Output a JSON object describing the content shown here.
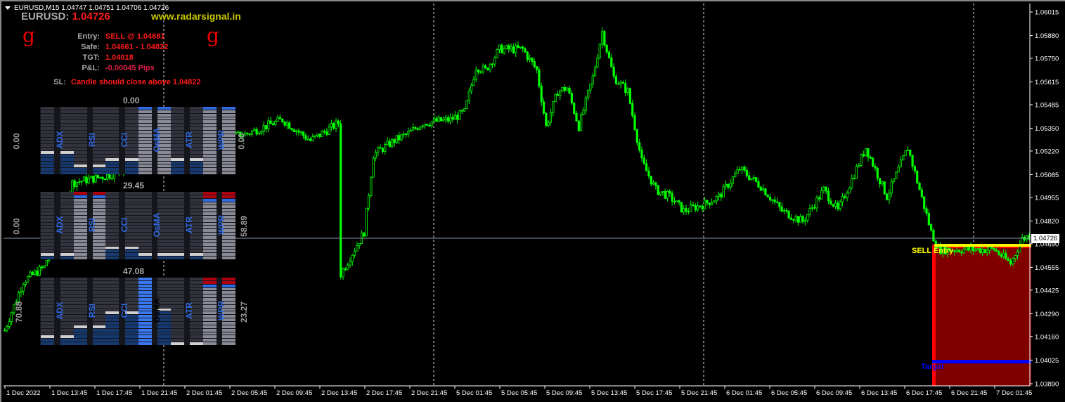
{
  "header": {
    "title": "EURUSD,M15 1.04747 1.04751 1.04706 1.04726"
  },
  "info": {
    "symbol": "EURUSD:",
    "price": "1.04726",
    "website": "www.radarsignal.in",
    "logo_glyph": "g",
    "entry_label": "Entry:",
    "entry_value": "SELL @ 1.04681",
    "safe_label": "Safe:",
    "safe_value": "1.04661 - 1.04822",
    "tgt_label": "TGT:",
    "tgt_value": "1.04018",
    "pnl_label": "P&L:",
    "pnl_value": "-0.00045 Pips",
    "sl_label": "SL:",
    "sl_value": "Candle should close above 1.04822"
  },
  "panels": [
    {
      "top_value": "0.00",
      "left_value": "0.00",
      "right_value": "0.00",
      "columns": [
        {
          "level": 0.3
        },
        {
          "level": 0.3
        },
        {
          "level": 0.1
        },
        {
          "level": 0.1
        },
        {
          "level": 0.2
        },
        {
          "level": 0.2
        },
        {
          "level": 1,
          "top": [
            "blue"
          ]
        },
        {
          "level": 1,
          "top": [
            "blue"
          ]
        },
        {
          "level": 0.2
        },
        {
          "level": 0.2
        },
        {
          "level": 1,
          "top": [
            "blue"
          ]
        },
        {
          "level": 1,
          "top": [
            "blue"
          ]
        }
      ]
    },
    {
      "top_value": "29.45",
      "left_value": "0.00",
      "right_value": "58.89",
      "columns": [
        {
          "level": 0.05
        },
        {
          "level": 0.05
        },
        {
          "level": 1,
          "top": [
            "red",
            "blue"
          ]
        },
        {
          "level": 1,
          "top": [
            "red",
            "blue"
          ]
        },
        {
          "level": 0.15
        },
        {
          "level": 0.15
        },
        {
          "level": 0.05
        },
        {
          "level": 0.05
        },
        {
          "level": 0.05
        },
        {
          "level": 0.05
        },
        {
          "level": 1,
          "top": [
            "red",
            "red",
            "blue"
          ]
        },
        {
          "level": 1,
          "top": [
            "red",
            "red",
            "blue"
          ]
        }
      ]
    },
    {
      "top_value": "47.08",
      "left_value": "70.88",
      "right_value": "23.27",
      "columns": [
        {
          "level": 0.1
        },
        {
          "level": 0.1
        },
        {
          "level": 0.25
        },
        {
          "level": 0.25
        },
        {
          "level": 0.45
        },
        {
          "level": 0.45
        },
        {
          "level": 0.55,
          "highlight": true
        },
        {
          "level": 0.55
        },
        {
          "level": 0
        },
        {
          "level": 0
        },
        {
          "level": 1,
          "top": [
            "red",
            "red",
            "blue"
          ]
        },
        {
          "level": 1,
          "top": [
            "red",
            "red",
            "blue"
          ]
        }
      ]
    }
  ],
  "indicators": [
    "ADX",
    "RSI",
    "CCI",
    "OsMA",
    "ATR",
    "WPR"
  ],
  "price_axis": [
    "1.06015",
    "1.05880",
    "1.05750",
    "1.05615",
    "1.05485",
    "1.05350",
    "1.05220",
    "1.05085",
    "1.04955",
    "1.04820",
    "1.04690",
    "1.04555",
    "1.04425",
    "1.04290",
    "1.04160",
    "1.04025",
    "1.03890"
  ],
  "current_price": "1.04726",
  "time_axis": [
    "1 Dec 2022",
    "1 Dec 13:45",
    "1 Dec 17:45",
    "1 Dec 21:45",
    "2 Dec 01:45",
    "2 Dec 05:45",
    "2 Dec 09:45",
    "2 Dec 13:45",
    "2 Dec 17:45",
    "2 Dec 21:45",
    "5 Dec 01:45",
    "5 Dec 05:45",
    "5 Dec 09:45",
    "5 Dec 13:45",
    "5 Dec 17:45",
    "5 Dec 21:45",
    "6 Dec 01:45",
    "6 Dec 05:45",
    "6 Dec 09:45",
    "6 Dec 13:45",
    "6 Dec 17:45",
    "6 Dec 21:45",
    "7 Dec 01:45"
  ],
  "trade": {
    "entry_label": "SELL Entry",
    "target_label": "Target",
    "entry_price": 1.04681,
    "target_price": 1.04018,
    "zone_top": 1.04661
  },
  "colors": {
    "candle": "#00ff00",
    "zone": "#800000",
    "zone_border": "#ff0000",
    "entry_line": "#ffff00",
    "target_line": "#0000ff"
  },
  "price_path": [
    [
      0,
      1.04195
    ],
    [
      8,
      1.04477
    ],
    [
      17,
      1.04557
    ],
    [
      29,
      1.05039
    ],
    [
      44,
      1.05079
    ],
    [
      59,
      1.05159
    ],
    [
      71,
      1.0532
    ],
    [
      89,
      1.0528
    ],
    [
      104,
      1.0532
    ],
    [
      119,
      1.054
    ],
    [
      131,
      1.0528
    ],
    [
      143,
      1.0538
    ],
    [
      144,
      1.04517
    ],
    [
      149,
      1.04637
    ],
    [
      154,
      1.04758
    ],
    [
      158,
      1.052
    ],
    [
      167,
      1.0528
    ],
    [
      173,
      1.0532
    ],
    [
      179,
      1.0538
    ],
    [
      191,
      1.054
    ],
    [
      197,
      1.05441
    ],
    [
      202,
      1.05702
    ],
    [
      206,
      1.05682
    ],
    [
      212,
      1.05802
    ],
    [
      222,
      1.05802
    ],
    [
      228,
      1.05682
    ],
    [
      232,
      1.0536
    ],
    [
      237,
      1.05561
    ],
    [
      241,
      1.05581
    ],
    [
      246,
      1.0536
    ],
    [
      252,
      1.05641
    ],
    [
      256,
      1.05903
    ],
    [
      261,
      1.05641
    ],
    [
      267,
      1.05561
    ],
    [
      273,
      1.05159
    ],
    [
      279,
      1.04999
    ],
    [
      285,
      1.04959
    ],
    [
      291,
      1.04878
    ],
    [
      300,
      1.04918
    ],
    [
      306,
      1.04959
    ],
    [
      315,
      1.05119
    ],
    [
      324,
      1.05019
    ],
    [
      333,
      1.04878
    ],
    [
      342,
      1.04818
    ],
    [
      351,
      1.04999
    ],
    [
      357,
      1.04878
    ],
    [
      369,
      1.0524
    ],
    [
      378,
      1.04959
    ],
    [
      387,
      1.0524
    ],
    [
      397,
      1.04758
    ],
    [
      400,
      1.04657
    ],
    [
      424,
      1.04657
    ],
    [
      431,
      1.04577
    ],
    [
      436,
      1.04718
    ],
    [
      439,
      1.04738
    ]
  ]
}
